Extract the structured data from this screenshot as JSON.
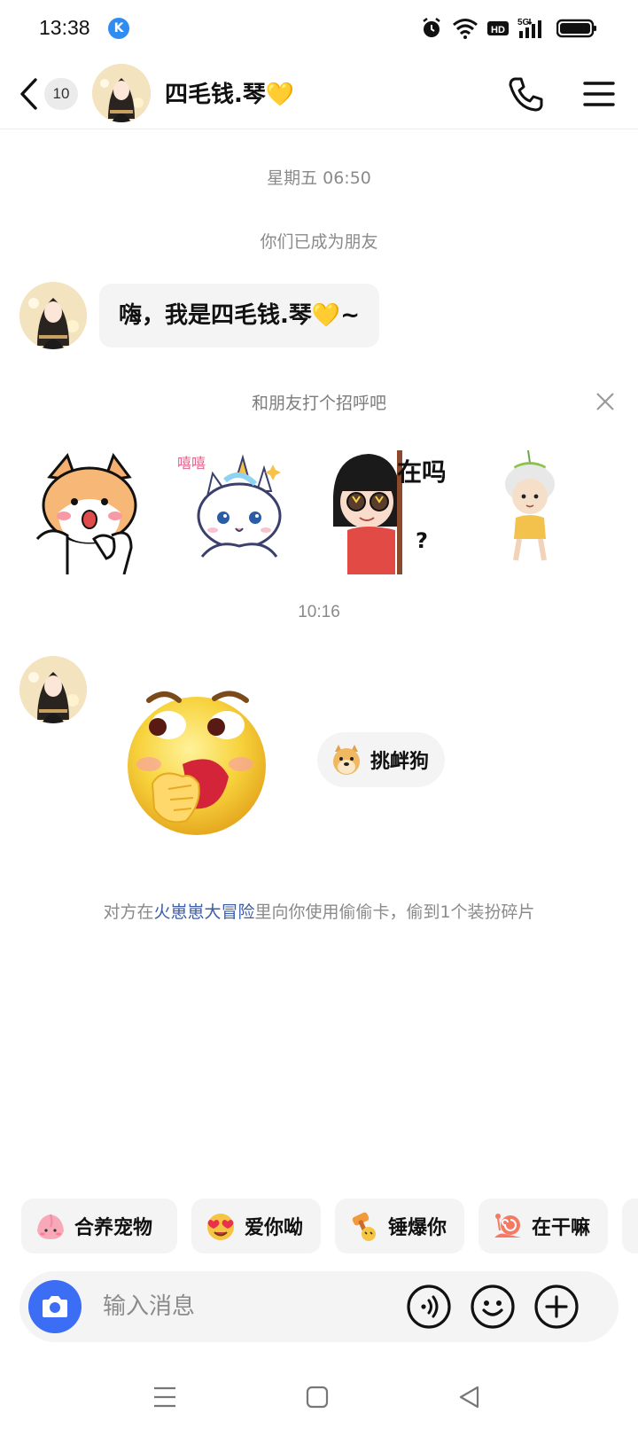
{
  "status_bar": {
    "time": "13:38",
    "app_badge": "K",
    "network": "5G"
  },
  "header": {
    "unread_count": "10",
    "contact_name": "四毛钱.琴💛"
  },
  "chat": {
    "timestamp_1": "星期五 06:50",
    "friends_notice": "你们已成为朋友",
    "first_message": "嗨，我是四毛钱.琴💛~",
    "greet_prompt": "和朋友打个招呼吧",
    "stickers": [
      "corgi-sticker",
      "unicorn-cat-sticker",
      "girl-在吗-sticker",
      "fairy-sticker"
    ],
    "sticker_text": {
      "xixi": "嘻嘻",
      "zaima": "在吗"
    },
    "timestamp_2": "10:16",
    "tease_label": "挑衅狗",
    "notice_prefix": "对方在",
    "notice_game": "火崽崽大冒险",
    "notice_suffix": "里向你使用偷偷卡，偷到1个装扮碎片"
  },
  "quick_replies": [
    {
      "label": "合养宠物",
      "icon": "peach-pet-icon"
    },
    {
      "label": "爱你呦",
      "icon": "heart-eyes-icon"
    },
    {
      "label": "锤爆你",
      "icon": "hammer-icon"
    },
    {
      "label": "在干嘛",
      "icon": "snail-icon"
    }
  ],
  "input": {
    "placeholder": "输入消息"
  },
  "colors": {
    "accent": "#3b6ef5",
    "bubble": "#f4f4f4",
    "game_link": "#3b5da8"
  }
}
